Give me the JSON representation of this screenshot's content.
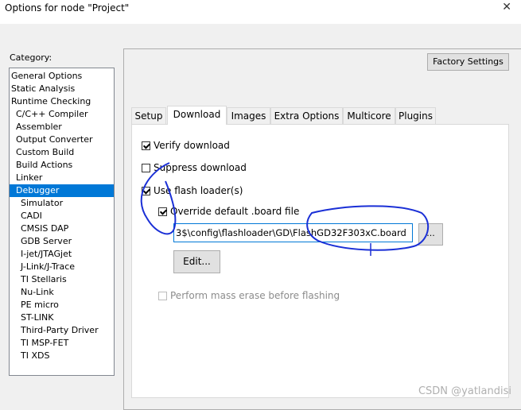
{
  "window": {
    "title": "Options for node \"Project\"",
    "close_icon": "close-icon"
  },
  "category": {
    "label": "Category:",
    "items": [
      {
        "label": "General Options",
        "level": 1
      },
      {
        "label": "Static Analysis",
        "level": 1
      },
      {
        "label": "Runtime Checking",
        "level": 1
      },
      {
        "label": "C/C++ Compiler",
        "level": 2
      },
      {
        "label": "Assembler",
        "level": 2
      },
      {
        "label": "Output Converter",
        "level": 2
      },
      {
        "label": "Custom Build",
        "level": 2
      },
      {
        "label": "Build Actions",
        "level": 2
      },
      {
        "label": "Linker",
        "level": 2
      },
      {
        "label": "Debugger",
        "level": 2,
        "selected": true
      },
      {
        "label": "Simulator",
        "level": 3
      },
      {
        "label": "CADI",
        "level": 3
      },
      {
        "label": "CMSIS DAP",
        "level": 3
      },
      {
        "label": "GDB Server",
        "level": 3
      },
      {
        "label": "I-jet/JTAGjet",
        "level": 3
      },
      {
        "label": "J-Link/J-Trace",
        "level": 3
      },
      {
        "label": "TI Stellaris",
        "level": 3
      },
      {
        "label": "Nu-Link",
        "level": 3
      },
      {
        "label": "PE micro",
        "level": 3
      },
      {
        "label": "ST-LINK",
        "level": 3
      },
      {
        "label": "Third-Party Driver",
        "level": 3
      },
      {
        "label": "TI MSP-FET",
        "level": 3
      },
      {
        "label": "TI XDS",
        "level": 3
      }
    ]
  },
  "factory_settings_label": "Factory Settings",
  "tabs": [
    {
      "label": "Setup"
    },
    {
      "label": "Download",
      "active": true
    },
    {
      "label": "Images"
    },
    {
      "label": "Extra Options"
    },
    {
      "label": "Multicore"
    },
    {
      "label": "Plugins"
    }
  ],
  "download": {
    "verify_label": "Verify download",
    "verify_checked": true,
    "suppress_label": "Suppress download",
    "suppress_checked": false,
    "flash_loader_label": "Use flash loader(s)",
    "flash_loader_checked": true,
    "override_label": "Override default .board file",
    "override_checked": true,
    "board_path": "3$\\config\\flashloader\\GD\\FlashGD32F303xC.board",
    "browse_label": "...",
    "edit_label": "Edit...",
    "mass_erase_label": "Perform mass erase before flashing",
    "mass_erase_checked": false,
    "mass_erase_enabled": false
  },
  "watermark": "CSDN @yatlandisi",
  "annotation_color": "#1a2fd6"
}
